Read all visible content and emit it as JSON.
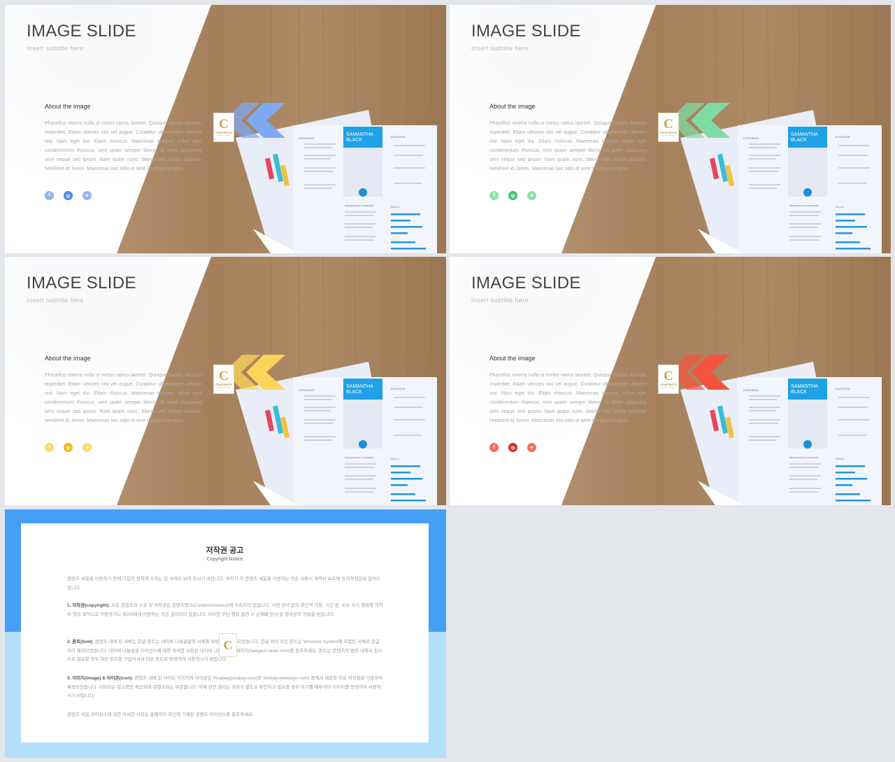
{
  "slides": [
    {
      "title": "IMAGE SLIDE",
      "subtitle": "Insert  subtitle  here",
      "about": "About  the  image",
      "body": "Phasellus viverra nulla ut metus varius laoreet. Quisque rutrum. Aenean imperdiet. Etiam ultricies nisi vel augue. Curabitur ullamcorper ultricies nisi. Nam eget dui. Etiam rhoncus. Maecenas tempus, tellus eget condimentum rhoncus, sem quam semper libero, sit amet adipiscing sem neque sed ipsum. Nam quam nunc, blandit vel, luctus pulvinar, hendrerit id, lorem. Maecenas nec odio et ante tincidunt tempus.",
      "accent": "#7fa8f5",
      "accent_dark": "#4f86e8",
      "socials": [
        "facebook-icon",
        "instagram-icon",
        "twitter-icon"
      ]
    },
    {
      "title": "IMAGE SLIDE",
      "subtitle": "Insert  subtitle  here",
      "about": "About  the  image",
      "body": "Phasellus viverra nulla ut metus varius laoreet. Quisque rutrum. Aenean imperdiet. Etiam ultricies nisi vel augue. Curabitur ullamcorper ultricies nisi. Nam eget dui. Etiam rhoncus. Maecenas tempus, tellus eget condimentum rhoncus, sem quam semper libero, sit amet adipiscing sem neque sed ipsum. Nam quam nunc, blandit vel, luctus pulvinar, hendrerit id, lorem. Maecenas nec odio et ante tincidunt tempus.",
      "accent": "#7ddba3",
      "accent_dark": "#3fc17a",
      "socials": [
        "facebook-icon",
        "instagram-icon",
        "twitter-icon"
      ]
    },
    {
      "title": "IMAGE SLIDE",
      "subtitle": "Insert  subtitle  here",
      "about": "About  the  image",
      "body": "Phasellus viverra nulla ut metus varius laoreet. Quisque rutrum. Aenean imperdiet. Etiam ultricies nisi vel augue. Curabitur ullamcorper ultricies nisi. Nam eget dui. Etiam rhoncus. Maecenas tempus, tellus eget condimentum rhoncus, sem quam semper libero, sit amet adipiscing sem neque sed ipsum. Nam quam nunc, blandit vel, luctus pulvinar, hendrerit id, lorem. Maecenas nec odio et ante tincidunt tempus.",
      "accent": "#fcd45a",
      "accent_dark": "#f0b915",
      "socials": [
        "facebook-icon",
        "instagram-icon",
        "twitter-icon"
      ]
    },
    {
      "title": "IMAGE SLIDE",
      "subtitle": "Insert  subtitle  here",
      "about": "About  the  image",
      "body": "Phasellus viverra nulla ut metus varius laoreet. Quisque rutrum. Aenean imperdiet. Etiam ultricies nisi vel augue. Curabitur ullamcorper ultricies nisi. Nam eget dui. Etiam rhoncus. Maecenas tempus, tellus eget condimentum rhoncus, sem quam semper libero, sit amet adipiscing sem neque sed ipsum. Nam quam nunc, blandit vel, luctus pulvinar, hendrerit id, lorem. Maecenas nec odio et ante tincidunt tempus.",
      "accent": "#f4543f",
      "accent_dark": "#d62b2b",
      "socials": [
        "facebook-icon",
        "instagram-icon",
        "twitter-icon"
      ]
    }
  ],
  "resume": {
    "name_line1": "SAMANTHA",
    "name_line2": "BLACK",
    "sections": [
      "EXPERIENCE",
      "EDUCATION",
      "SKILLS",
      "PROFESSIONAL STATEMENT"
    ]
  },
  "logo": {
    "letter": "C",
    "text": "CONTENTS",
    "subtext": "BANK STORE"
  },
  "notice": {
    "title": "저작권 공고",
    "subtitle": "Copyright Notice",
    "intro": "콘텐츠 세움을 사용하기 전에 다음의 원칙에 소하는 일 사례이 보여 주시기 바랍니다. 귀하가 이 콘텐츠 세움을 사용하는 것은 사용시 계약서 보호에 동의하셨음을 알려드립니다.",
    "items": [
      {
        "label": "1. 저작권(copyright):",
        "text": "모든 콘텐츠의 소유 및 저작권은 콘텐츠뱅크(Contentstokeout)에 귀속되어 있습니다. 사전 승낙 없이 무단적 이용, 기간 전, 비소 사기 행위에 의하여 영리 목적으로 이용하거나 제3자에게 이용하는 것은 금지되어 있습니다. 이러한 무단 행위 발견 시 손해배 민사 및 형사상의 처벌을 받습니다."
      },
      {
        "label": "2. 폰트(font):",
        "text": "콘텐츠 내에 된 서체는 한글 폰트는 네이버 나눔글꼴의 서체를 바탕하여 제작되었습니다. 한글 외의 모든 폰트는 Windows System에 포함된 서체로 공급되어 제작되었습니다. 네이버 나눔글꼴 라이선스에 대한 자세한 사항은 네이버 나눔글꼴 홈페이지(hangeul.naver.com)를 참조하세요. 폰트는 콘텐츠의 범위 내에서 있으므로 필요할 경우 해당 폰트를 구입하셔서 다른 폰트로 변경하여 사용하시기 바랍니다."
      },
      {
        "label": "3. 이미지(image) & 아이콘(icon):",
        "text": "콘텐츠 내에 된 사이트 이미지와 아이콘은 Pixabay(pixabay.com)와 Webalys(webalys.com) 등에서 제공한 무료 저작물을 이용하여 제작되었습니다. 이미지는 참고용만 제공되며 콘텐츠와는 무관합니다. 이에 관한 권리는 귀하가 별도로 확인하고 필요할 경우 여기를 해두어야 이미지를 변경하여 사용하시기 바랍니다."
      }
    ],
    "footer": "콘텐츠 세움 라이선스에 대한 자세한 사항은 홈페이지 하단에 기재된 콘텐츠 라이선스를 참조하세요."
  }
}
